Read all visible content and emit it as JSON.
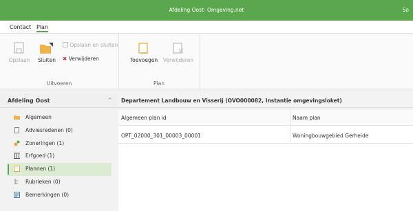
{
  "window": {
    "title": "Afdeling Oost- Omgeving.net",
    "user": "So"
  },
  "menu": {
    "tabs": [
      {
        "label": "Contact"
      },
      {
        "label": "Plan"
      }
    ]
  },
  "ribbon": {
    "groups": [
      {
        "label": "Uitvoeren",
        "save": "Opslaan",
        "close": "Sluiten",
        "save_close": "Opslaan en sluiten",
        "delete": "Verwijderen"
      },
      {
        "label": "Plan",
        "add": "Toevoegen",
        "delete": "Verwijderen"
      }
    ]
  },
  "sidebar": {
    "title": "Afdeling Oost",
    "collapse": "^",
    "items": [
      {
        "label": "Algemeen"
      },
      {
        "label": "Adviesredenen (0)"
      },
      {
        "label": "Zoneringen (1)"
      },
      {
        "label": "Erfgoed (1)"
      },
      {
        "label": "Plannen (1)"
      },
      {
        "label": "Rubrieken (0)"
      },
      {
        "label": "Bemerkingen (0)"
      }
    ]
  },
  "content": {
    "title": "Departement Landbouw en Visserij (OVO000082, Instantie omgevingsloket)",
    "columns": [
      "Algemeen plan id",
      "Naam plan"
    ],
    "rows": [
      [
        "OPT_02000_301_00003_00001",
        "Woningbouwgebied Gerheide"
      ]
    ]
  },
  "colors": {
    "accent": "#5ba74e",
    "folder": "#f0b34a",
    "selected": "#dcecd2"
  }
}
